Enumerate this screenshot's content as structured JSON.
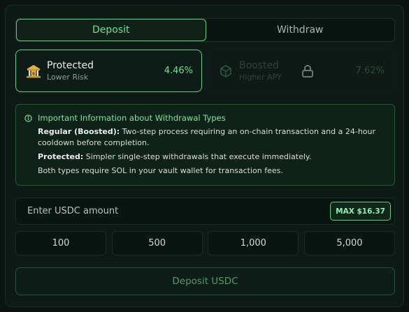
{
  "tabs": [
    {
      "label": "Deposit",
      "active": true
    },
    {
      "label": "Withdraw",
      "active": false
    }
  ],
  "vaults": {
    "protected": {
      "name": "Protected",
      "subtitle": "Lower Risk",
      "rate": "4.46%",
      "icon": "bank-icon",
      "selected": true
    },
    "boosted": {
      "name": "Boosted",
      "subtitle": "Higher APY",
      "rate": "7.62%",
      "icon": "cube-icon",
      "locked": true
    }
  },
  "info": {
    "title": "Important Information about Withdrawal Types",
    "regular_label": "Regular (Boosted):",
    "regular_text": " Two-step process requiring an on-chain transaction and a 24-hour cooldown before completion.",
    "protected_label": "Protected:",
    "protected_text": " Simpler single-step withdrawals that execute immediately.",
    "note": "Both types require SOL in your vault wallet for transaction fees."
  },
  "amount": {
    "placeholder": "Enter USDC amount",
    "value": "",
    "max_label": "MAX $16.37"
  },
  "presets": [
    "100",
    "500",
    "1,000",
    "5,000"
  ],
  "submit_label": "Deposit USDC",
  "colors": {
    "accent": "#5ecf83",
    "background": "#0d1a15",
    "info_bg": "#0f2219"
  }
}
